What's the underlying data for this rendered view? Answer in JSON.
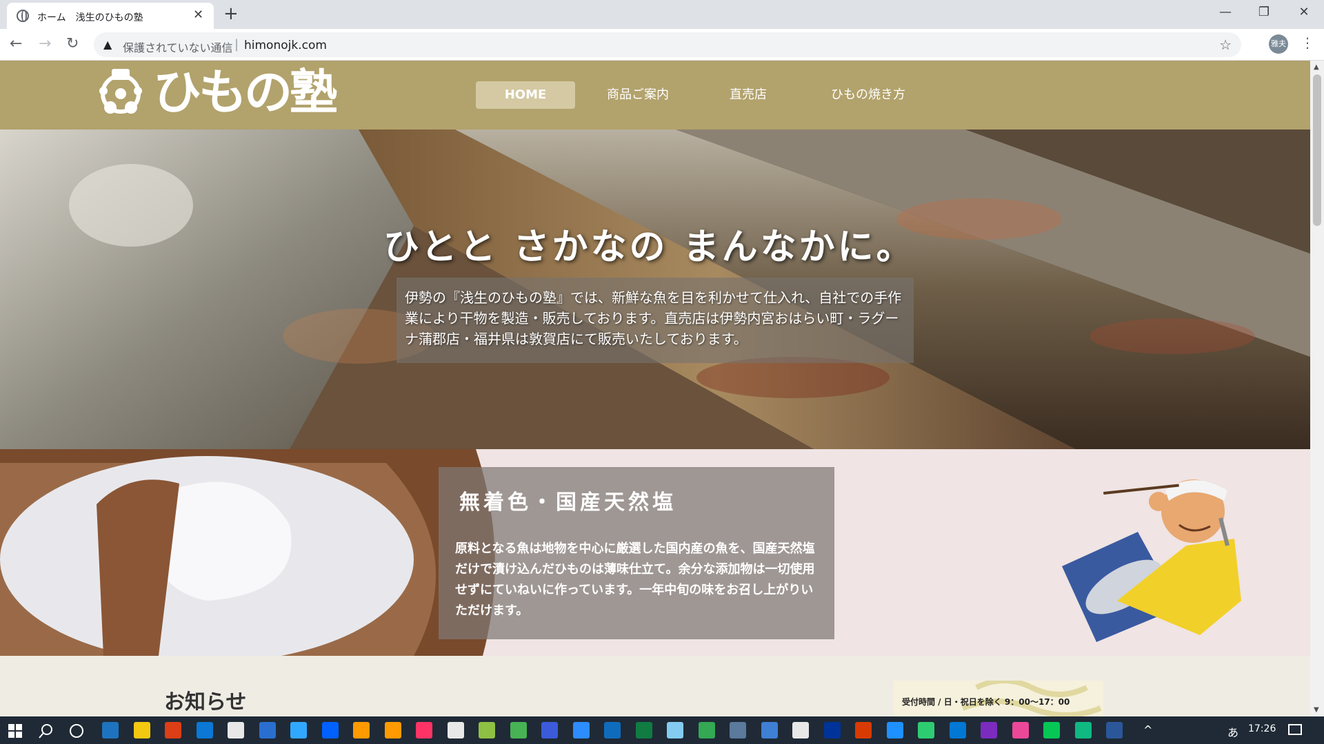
{
  "browser": {
    "tab_title": "ホーム　浅生のひもの塾",
    "tab_close": "✕",
    "new_tab": "+",
    "security_text": "保護されていない通信",
    "url": "himonojk.com",
    "avatar_text": "雅夫",
    "window_minimize": "—",
    "window_restore": "❐",
    "window_close": "✕"
  },
  "site": {
    "logo_text": "ひもの塾",
    "nav": [
      {
        "label": "HOME",
        "active": true
      },
      {
        "label": "商品ご案内",
        "active": false
      },
      {
        "label": "直売店",
        "active": false
      },
      {
        "label": "ひもの焼き方",
        "active": false
      }
    ],
    "hero": {
      "tagline": "ひとと さかなの まんなかに。",
      "text": "伊勢の『浅生のひもの塾』では、新鮮な魚を目を利かせて仕入れ、自社での手作業により干物を製造・販売しております。直売店は伊勢内宮おはらい町・ラグーナ蒲郡店・福井県は敦賀店にて販売いたしております。"
    },
    "feature": {
      "title": "無着色・国産天然塩",
      "body": "原料となる魚は地物を中心に厳選した国内産の魚を、国産天然塩だけで漬け込んだひものは薄味仕立て。余分な添加物は一切使用せずにていねいに作っています。一年中旬の味をお召し上がりいただけます。"
    },
    "news_title": "お知らせ",
    "hours_text": "受付時間 / 日・祝日を除く 9：00～17：00"
  },
  "taskbar": {
    "time": "17:26",
    "ime": "あ",
    "colors": [
      "#1e73be",
      "#f2c811",
      "#dc3e15",
      "#0a78d4",
      "#e8e8e8",
      "#2a6fd0",
      "#31a8ff",
      "#0061fe",
      "#ff9a00",
      "#ff9a00",
      "#ff3366",
      "#e8e8e8",
      "#8ec044",
      "#47b354",
      "#3b5bdb",
      "#2d8cff",
      "#0f6cbd",
      "#107c41",
      "#83cbf0",
      "#34a853",
      "#5b7a9c",
      "#3f7fd4",
      "#e8e8e8",
      "#003399",
      "#d83b01",
      "#1e90ff",
      "#2ecc71",
      "#0078d4",
      "#7b2cbf",
      "#ec4899",
      "#06c755",
      "#10b981",
      "#2b579a"
    ]
  }
}
